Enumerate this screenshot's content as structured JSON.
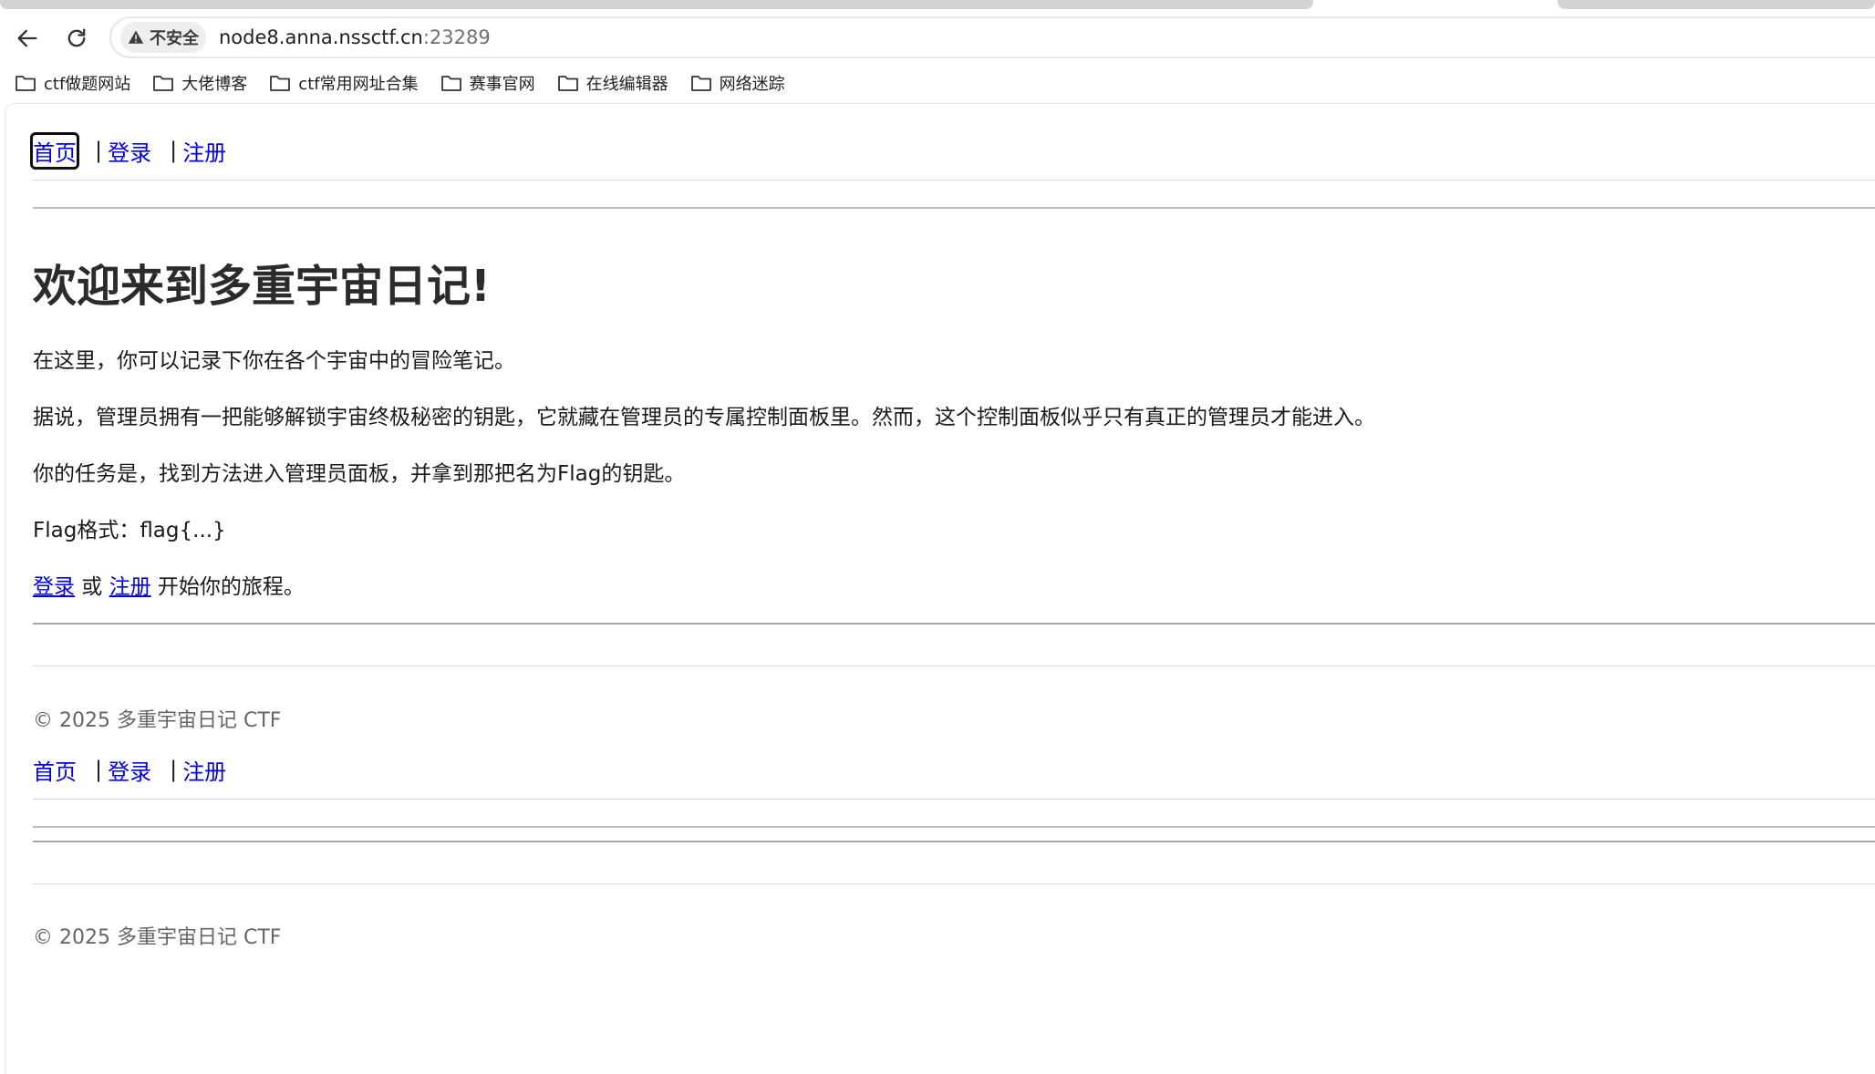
{
  "browser": {
    "url_host": "node8.anna.nssctf.cn",
    "url_port": ":23289",
    "security_label": "不安全",
    "bookmarks": [
      {
        "label": "ctf做题网站"
      },
      {
        "label": "大佬博客"
      },
      {
        "label": "ctf常用网址合集"
      },
      {
        "label": "赛事官网"
      },
      {
        "label": "在线编辑器"
      },
      {
        "label": "网络迷踪"
      }
    ]
  },
  "nav": {
    "home": "首页",
    "sep": "|",
    "login": "登录",
    "register": "注册"
  },
  "main": {
    "title": "欢迎来到多重宇宙日记!",
    "para1": "在这里，你可以记录下你在各个宇宙中的冒险笔记。",
    "para2": "据说，管理员拥有一把能够解锁宇宙终极秘密的钥匙，它就藏在管理员的专属控制面板里。然而，这个控制面板似乎只有真正的管理员才能进入。",
    "para3": "你的任务是，找到方法进入管理员面板，并拿到那把名为Flag的钥匙。",
    "para4": "Flag格式：flag{...}",
    "cta_login": "登录",
    "cta_or": " 或 ",
    "cta_register": "注册",
    "cta_rest": " 开始你的旅程。"
  },
  "footer": {
    "copyright": "© 2025 多重宇宙日记 CTF"
  }
}
